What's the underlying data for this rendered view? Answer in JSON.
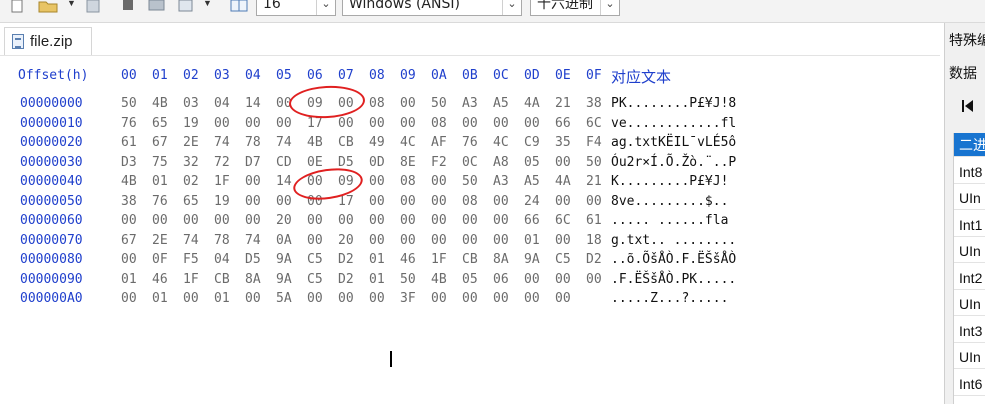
{
  "toolbar": {
    "bytes_per_row": "16",
    "charset": "Windows (ANSI)",
    "radix": "十六进制",
    "icons": [
      "new-file-icon",
      "open-folder-icon",
      "save-icon",
      "print-icon",
      "properties-icon",
      "grid-icon"
    ]
  },
  "tab": {
    "filename": "file.zip"
  },
  "hex": {
    "offset_header": "Offset(h)",
    "col_headers": [
      "00",
      "01",
      "02",
      "03",
      "04",
      "05",
      "06",
      "07",
      "08",
      "09",
      "0A",
      "0B",
      "0C",
      "0D",
      "0E",
      "0F"
    ],
    "text_header": "对应文本",
    "rows": [
      {
        "offset": "00000000",
        "bytes": [
          "50",
          "4B",
          "03",
          "04",
          "14",
          "00",
          "09",
          "00",
          "08",
          "00",
          "50",
          "A3",
          "A5",
          "4A",
          "21",
          "38"
        ],
        "text": "PK........P£¥J!8"
      },
      {
        "offset": "00000010",
        "bytes": [
          "76",
          "65",
          "19",
          "00",
          "00",
          "00",
          "17",
          "00",
          "00",
          "00",
          "08",
          "00",
          "00",
          "00",
          "66",
          "6C"
        ],
        "text": "ve............fl"
      },
      {
        "offset": "00000020",
        "bytes": [
          "61",
          "67",
          "2E",
          "74",
          "78",
          "74",
          "4B",
          "CB",
          "49",
          "4C",
          "AF",
          "76",
          "4C",
          "C9",
          "35",
          "F4"
        ],
        "text": "ag.txtKËIL¯vLÉ5ô"
      },
      {
        "offset": "00000030",
        "bytes": [
          "D3",
          "75",
          "32",
          "72",
          "D7",
          "CD",
          "0E",
          "D5",
          "0D",
          "8E",
          "F2",
          "0C",
          "A8",
          "05",
          "00",
          "50"
        ],
        "text": "Óu2r×Í.Õ.Žò.¨..P"
      },
      {
        "offset": "00000040",
        "bytes": [
          "4B",
          "01",
          "02",
          "1F",
          "00",
          "14",
          "00",
          "09",
          "00",
          "08",
          "00",
          "50",
          "A3",
          "A5",
          "4A",
          "21"
        ],
        "text": "K.........P£¥J!"
      },
      {
        "offset": "00000050",
        "bytes": [
          "38",
          "76",
          "65",
          "19",
          "00",
          "00",
          "00",
          "17",
          "00",
          "00",
          "00",
          "08",
          "00",
          "24",
          "00",
          "00"
        ],
        "text": "8ve.........$.."
      },
      {
        "offset": "00000060",
        "bytes": [
          "00",
          "00",
          "00",
          "00",
          "00",
          "20",
          "00",
          "00",
          "00",
          "00",
          "00",
          "00",
          "00",
          "66",
          "6C",
          "61"
        ],
        "text": "..... ......fla"
      },
      {
        "offset": "00000070",
        "bytes": [
          "67",
          "2E",
          "74",
          "78",
          "74",
          "0A",
          "00",
          "20",
          "00",
          "00",
          "00",
          "00",
          "00",
          "01",
          "00",
          "18"
        ],
        "text": "g.txt.. ........"
      },
      {
        "offset": "00000080",
        "bytes": [
          "00",
          "0F",
          "F5",
          "04",
          "D5",
          "9A",
          "C5",
          "D2",
          "01",
          "46",
          "1F",
          "CB",
          "8A",
          "9A",
          "C5",
          "D2"
        ],
        "text": "..õ.ÕšÅÒ.F.ËŠšÅÒ"
      },
      {
        "offset": "00000090",
        "bytes": [
          "01",
          "46",
          "1F",
          "CB",
          "8A",
          "9A",
          "C5",
          "D2",
          "01",
          "50",
          "4B",
          "05",
          "06",
          "00",
          "00",
          "00"
        ],
        "text": ".F.ËŠšÅÒ.PK....."
      },
      {
        "offset": "000000A0",
        "bytes": [
          "00",
          "01",
          "00",
          "01",
          "00",
          "5A",
          "00",
          "00",
          "00",
          "3F",
          "00",
          "00",
          "00",
          "00",
          "00",
          ""
        ],
        "text": ".....Z...?....."
      }
    ]
  },
  "side_panel": {
    "title": "特殊编",
    "subtitle": "数据",
    "nav_icon": "first-page-icon",
    "items": [
      "二进",
      "Int8",
      "UIn",
      "Int1",
      "UIn",
      "Int2",
      "UIn",
      "Int3",
      "UIn",
      "Int6"
    ]
  },
  "annotation_color": "#e02020",
  "accent": "#1f3fcc"
}
